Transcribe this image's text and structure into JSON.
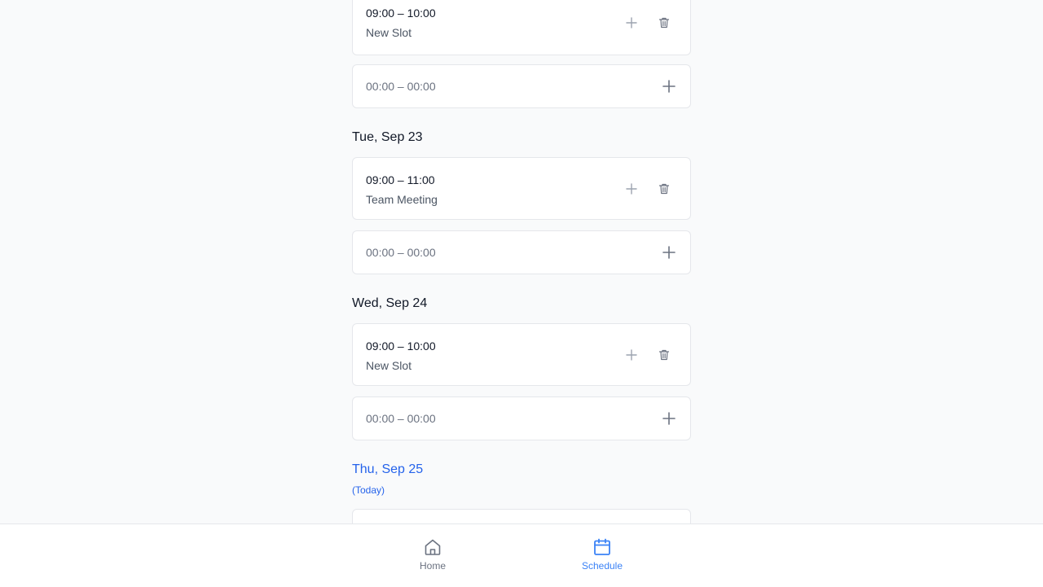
{
  "days": [
    {
      "label": "",
      "slots": [
        {
          "time": "09:00 – 10:00",
          "title": "New Slot"
        }
      ],
      "empty_time": "00:00 – 00:00"
    },
    {
      "label": "Tue, Sep 23",
      "slots": [
        {
          "time": "09:00 – 11:00",
          "title": "Team Meeting"
        }
      ],
      "empty_time": "00:00 – 00:00"
    },
    {
      "label": "Wed, Sep 24",
      "slots": [
        {
          "time": "09:00 – 10:00",
          "title": "New Slot"
        }
      ],
      "empty_time": "00:00 – 00:00"
    },
    {
      "label": "Thu, Sep 25",
      "sublabel": "(Today)",
      "is_today": true
    }
  ],
  "icons": {
    "add": "plus-icon",
    "delete": "trash-icon",
    "home": "home-icon",
    "schedule": "calendar-icon"
  },
  "colors": {
    "accent": "#2563eb",
    "nav_active": "#3b82f6",
    "background": "#f9fafb",
    "card_border": "#e5e7eb"
  },
  "nav": {
    "items": [
      {
        "label": "Home",
        "active": false
      },
      {
        "label": "Schedule",
        "active": true
      }
    ]
  }
}
